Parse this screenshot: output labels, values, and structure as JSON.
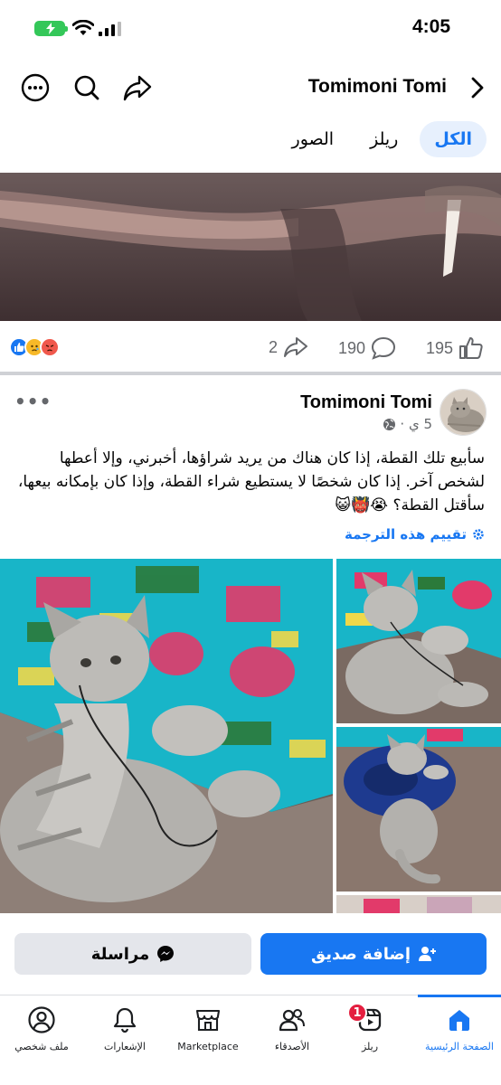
{
  "status_bar": {
    "time": "4:05"
  },
  "header": {
    "title": "Tomimoni Tomi"
  },
  "tabs": [
    {
      "label": "الكل",
      "active": true
    },
    {
      "label": "ريلز",
      "active": false
    },
    {
      "label": "الصور",
      "active": false
    }
  ],
  "reactions": {
    "emojis": [
      "like-icon",
      "sad-icon",
      "angry-icon"
    ],
    "likes": "195",
    "comments": "190",
    "shares": "2"
  },
  "post": {
    "author": "Tomimoni Tomi",
    "time": "5 ي ·",
    "text": "سأبيع تلك القطة، إذا كان هناك من يريد شراؤها، أخبرني، وإلا أعطها لشخص آخر. إذا كان شخصًا لا يستطيع شراء القطة، وإذا كان بإمكانه بيعها، سأقتل القطة؟ 😭👹😺",
    "translate_label": "تقييم هذه الترجمة"
  },
  "actions": {
    "add_friend": "إضافة صديق",
    "message": "مراسلة"
  },
  "nav": {
    "home": "الصفحة الرئيسية",
    "reels": "ريلز",
    "reels_badge": "1",
    "friends": "الأصدقاء",
    "marketplace": "Marketplace",
    "notifications": "الإشعارات",
    "profile": "ملف شخصي"
  },
  "colors": {
    "accent": "#1877f2",
    "badge": "#e41e3f",
    "battery": "#34c759"
  }
}
